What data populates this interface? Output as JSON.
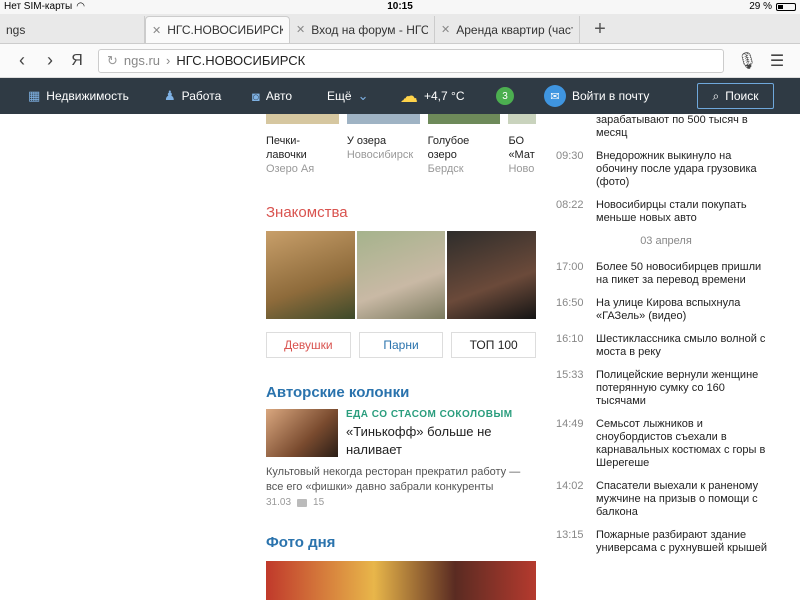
{
  "status": {
    "carrier": "Нет SIM-карты",
    "time": "10:15",
    "battery": "29 %",
    "battery_level": 0.29
  },
  "tabs": [
    {
      "label": "ngs",
      "active": false
    },
    {
      "label": "НГС.НОВОСИБИРСК",
      "active": true
    },
    {
      "label": "Вход на форум - НГС.",
      "active": false
    },
    {
      "label": "Аренда квартир (часть",
      "active": false
    }
  ],
  "address": {
    "back": "‹",
    "forward": "›",
    "ya": "Я",
    "domain": "ngs.ru",
    "separator": "›",
    "page": "НГС.НОВОСИБИРСК"
  },
  "sitenav": {
    "items": [
      "Недвижимость",
      "Работа",
      "Авто",
      "Ещё"
    ],
    "weather": "+4,7 °C",
    "badge": "3",
    "mail": "Войти в почту",
    "search": "Поиск"
  },
  "cards": [
    {
      "title": "Печки-лавочки",
      "sub": "Озеро Ая"
    },
    {
      "title": "У озера",
      "sub": "Новосибирск"
    },
    {
      "title": "Голубое озеро",
      "sub": "Бердск"
    },
    {
      "title": "БО «Мат",
      "sub": "Ново"
    }
  ],
  "dating": {
    "title": "Знакомства",
    "buttons": [
      "Девушки",
      "Парни",
      "ТОП 100"
    ]
  },
  "columns": {
    "title": "Авторские колонки",
    "kicker": "ЕДА СО СТАСОМ СОКОЛОВЫМ",
    "headline": "«Тинькофф» больше не наливает",
    "excerpt": "Культовый некогда ресторан прекратил работу — все его «фишки» давно забрали конкуренты",
    "date": "31.03",
    "comments": "15"
  },
  "photo_day": {
    "title": "Фото дня"
  },
  "news_top": [
    {
      "time": "",
      "text": "зарабатывают по 500 тысяч в месяц"
    },
    {
      "time": "09:30",
      "text": "Внедорожник выкинуло на обочину после удара грузовика (фото)"
    },
    {
      "time": "08:22",
      "text": "Новосибирцы стали покупать меньше новых авто"
    }
  ],
  "news_date": "03 апреля",
  "news_bottom": [
    {
      "time": "17:00",
      "text": "Более 50 новосибирцев пришли на пикет за перевод времени"
    },
    {
      "time": "16:50",
      "text": "На улице Кирова вспыхнула «ГАЗель» (видео)"
    },
    {
      "time": "16:10",
      "text": "Шестиклассника смыло волной с моста в реку"
    },
    {
      "time": "15:33",
      "text": "Полицейские вернули женщине потерянную сумку со 160 тысячами"
    },
    {
      "time": "14:49",
      "text": "Семьсот лыжников и сноубордистов съехали в карнавальных костюмах с горы в Шерегеше"
    },
    {
      "time": "14:02",
      "text": "Спасатели выехали к раненому мужчине на призыв о помощи с балкона"
    },
    {
      "time": "13:15",
      "text": "Пожарные разбирают здание универсама с рухнувшей крышей"
    }
  ],
  "colors": {
    "nav_bg": "#2f3a44",
    "accent_red": "#d9534f",
    "accent_blue": "#2a73ad"
  }
}
